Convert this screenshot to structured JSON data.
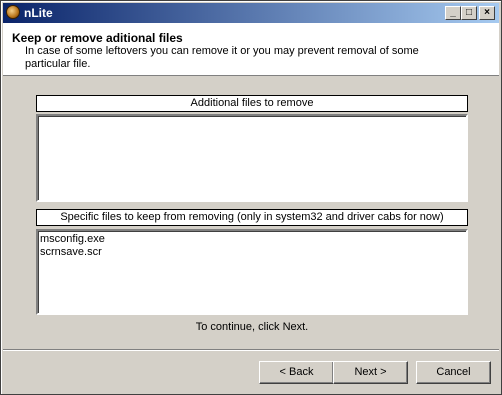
{
  "window": {
    "title": "nLite"
  },
  "header": {
    "title": "Keep or remove aditional files",
    "description": "In case of some leftovers you can remove it or you may prevent removal of some particular file."
  },
  "remove_section": {
    "label": "Additional files to remove",
    "items": []
  },
  "keep_section": {
    "label": "Specific files to keep from removing (only in system32 and driver cabs for now)",
    "items": [
      "msconfig.exe",
      "scrnsave.scr"
    ]
  },
  "footer": {
    "continue_text": "To continue, click Next.",
    "back_label": "< Back",
    "next_label": "Next >",
    "cancel_label": "Cancel"
  }
}
